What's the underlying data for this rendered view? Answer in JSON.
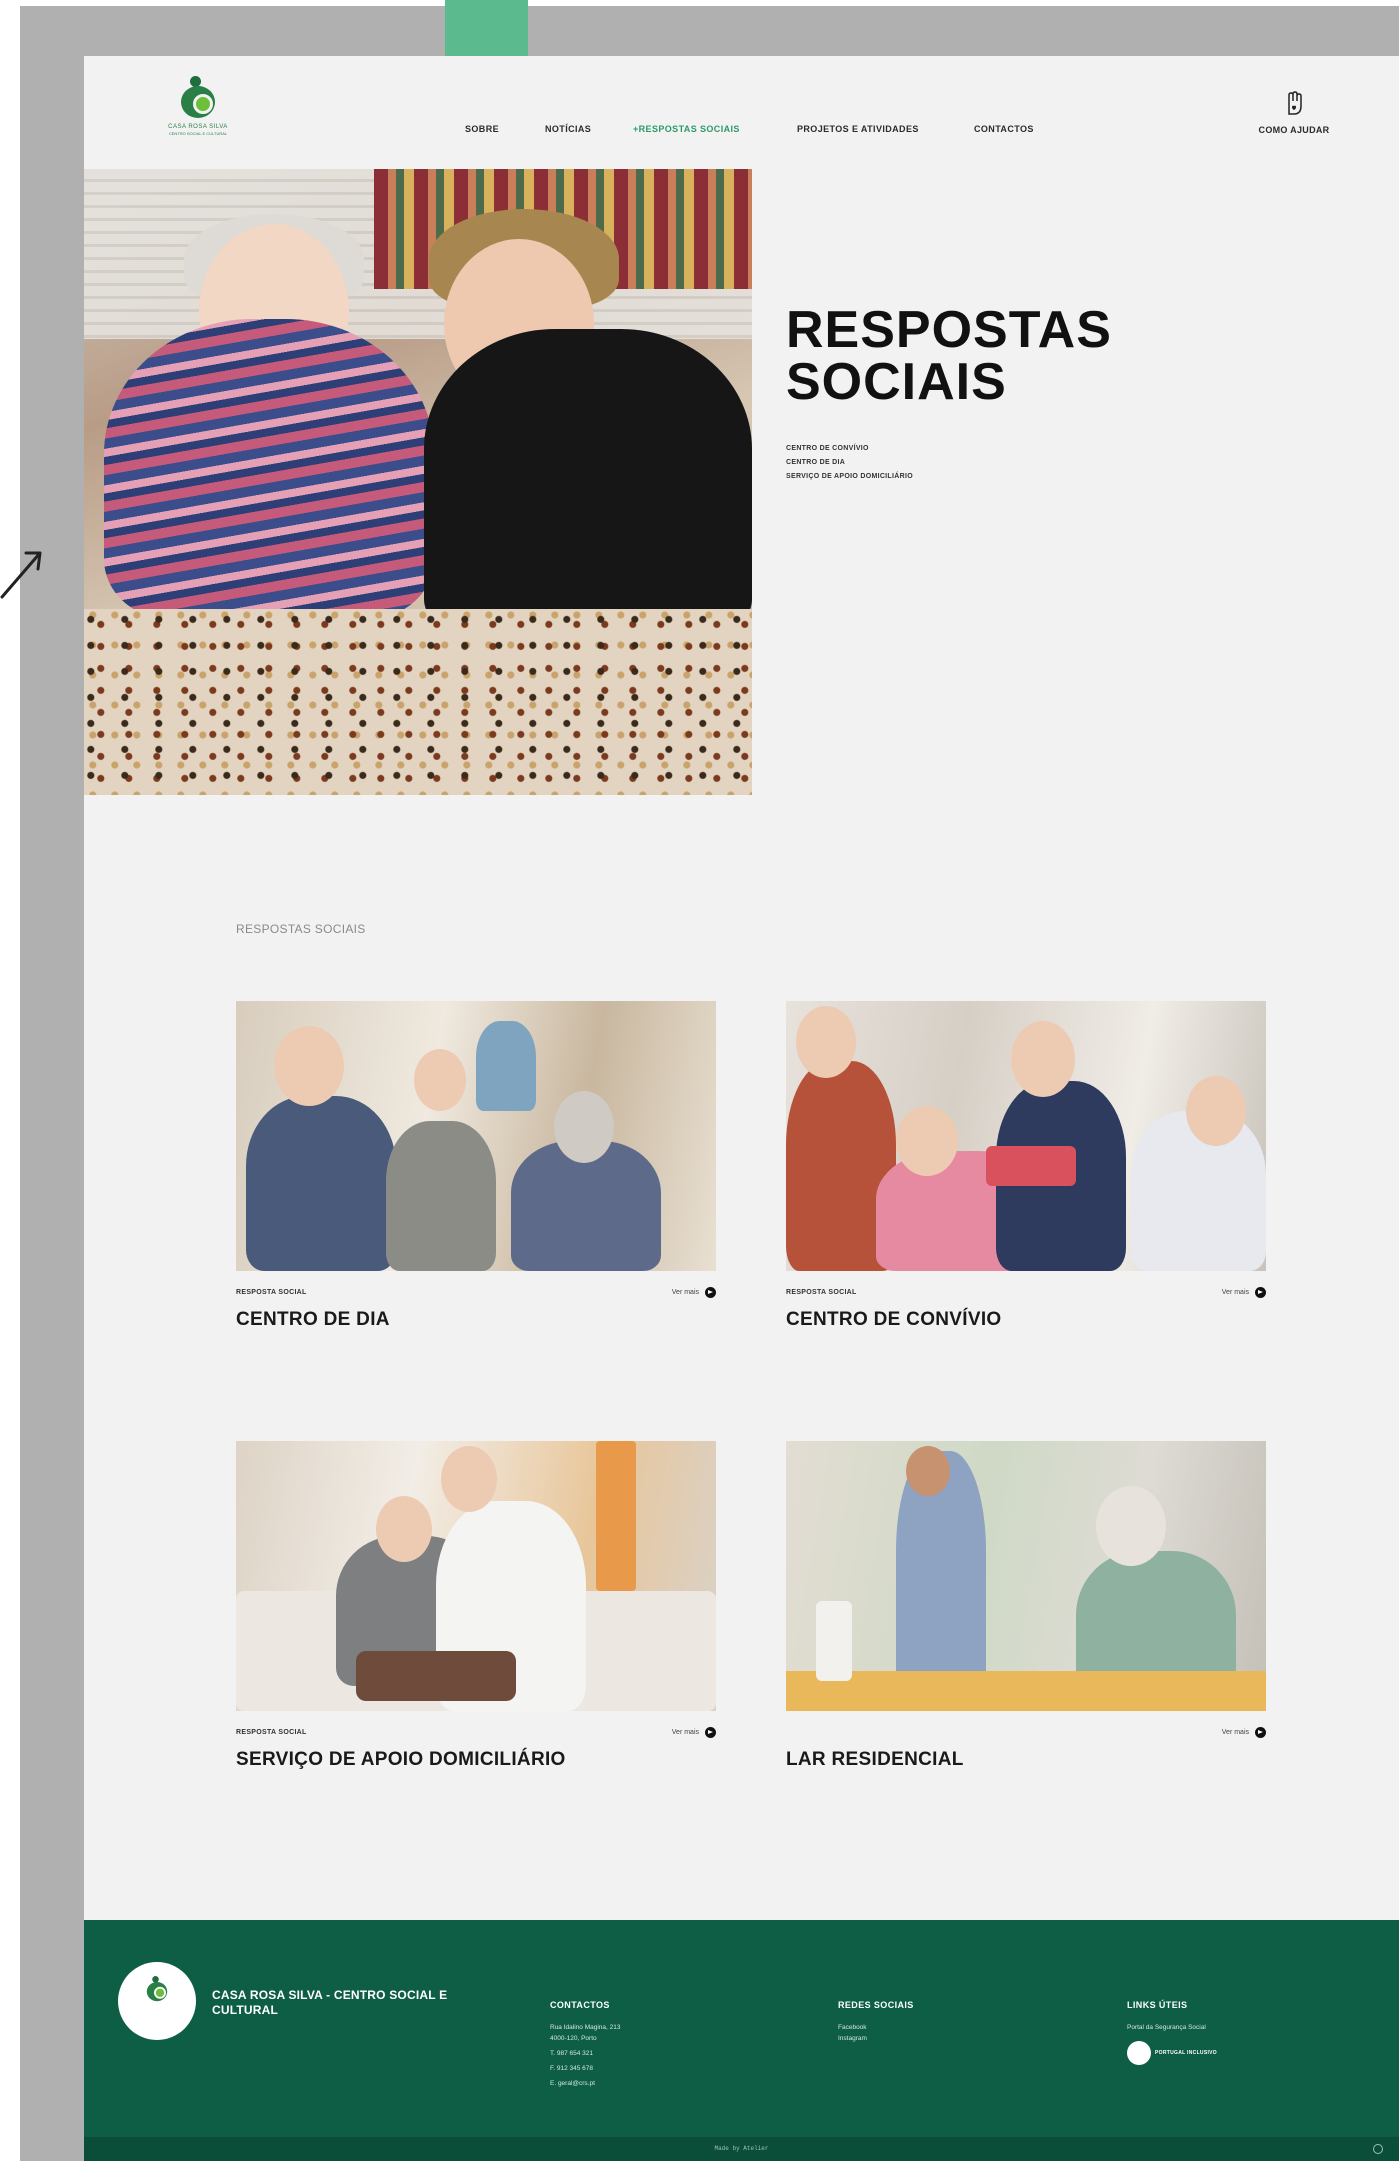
{
  "brand": {
    "name": "CASA ROSA SILVA",
    "tagline": "CENTRO SOCIAL E CULTURAL",
    "primary_color": "#0d5e45",
    "accent_color": "#2c9a6a"
  },
  "nav": {
    "items": [
      {
        "label": "SOBRE"
      },
      {
        "label": "NOTÍCIAS"
      },
      {
        "label": "+RESPOSTAS SOCIAIS",
        "active": true
      },
      {
        "label": "PROJETOS E ATIVIDADES"
      },
      {
        "label": "CONTACTOS"
      }
    ],
    "help": {
      "label": "COMO AJUDAR",
      "icon": "hand-heart-icon"
    }
  },
  "hero": {
    "title_line1": "RESPOSTAS",
    "title_line2": "SOCIAIS",
    "links": [
      "CENTRO DE CONVÍVIO",
      "CENTRO DE DIA",
      "SERVIÇO DE APOIO DOMICILIÁRIO"
    ]
  },
  "section": {
    "label": "RESPOSTAS SOCIAIS",
    "cards": [
      {
        "kicker": "RESPOSTA SOCIAL",
        "title": "CENTRO DE DIA",
        "more": "Ver mais"
      },
      {
        "kicker": "RESPOSTA SOCIAL",
        "title": "CENTRO DE CONVÍVIO",
        "more": "Ver mais"
      },
      {
        "kicker": "RESPOSTA SOCIAL",
        "title": "SERVIÇO DE APOIO DOMICILIÁRIO",
        "more": "Ver mais"
      },
      {
        "kicker": "",
        "title": "LAR RESIDENCIAL",
        "more": "Ver mais"
      }
    ]
  },
  "footer": {
    "org_name": "CASA ROSA SILVA - CENTRO SOCIAL E CULTURAL",
    "contacts": {
      "heading": "CONTACTOS",
      "address1": "Rua Idalino Magina, 213",
      "address2": "4000-120, Porto",
      "phone1": "T. 987 654 321",
      "phone2": "F. 912 345 678",
      "email": "E. geral@crs.pt"
    },
    "social": {
      "heading": "REDES SOCIAIS",
      "items": [
        "Facebook",
        "Instagram"
      ]
    },
    "links": {
      "heading": "LINKS ÚTEIS",
      "item": "Portal da Segurança Social",
      "partner": "PORTUGAL INCLUSIVO"
    },
    "made_by": "Made by Atelier"
  }
}
